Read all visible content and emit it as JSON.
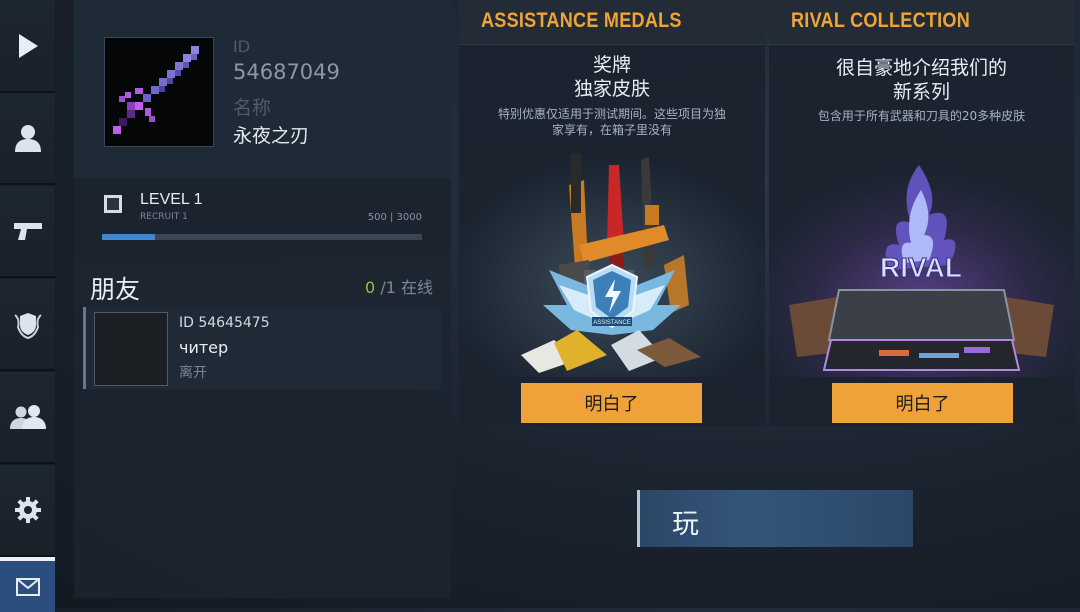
{
  "sidebar": {
    "items": [
      {
        "name": "play-icon"
      },
      {
        "name": "profile-icon"
      },
      {
        "name": "pistol-icon"
      },
      {
        "name": "shield-icon"
      },
      {
        "name": "friends-icon"
      },
      {
        "name": "gear-icon"
      },
      {
        "name": "mail-icon"
      }
    ],
    "active_color": "#2a4e7e"
  },
  "profile": {
    "id_label": "ID",
    "id_value": "54687049",
    "name_label": "名称",
    "name_value": "永夜之刃",
    "avatar_icon": "pixel-sword-icon"
  },
  "level": {
    "title": "LEVEL 1",
    "rank": "RECRUIT 1",
    "xp": "500 | 3000",
    "progress": 0.167
  },
  "friends": {
    "title": "朋友",
    "online_count": "0",
    "separator": "/",
    "total": "1",
    "online_label": "在线",
    "list": [
      {
        "id": "ID 54645475",
        "name": "читер",
        "status": "离开"
      }
    ]
  },
  "offers": [
    {
      "header": "ASSISTANCE MEDALS",
      "title_line1": "奖牌",
      "title_line2": "独家皮肤",
      "desc_line1": "特别优惠仅适用于测试期间。这些项目为独",
      "desc_line2": "家享有，在箱子里没有",
      "art_text": "ASSISTANCE",
      "button": "明白了"
    },
    {
      "header": "RIVAL COLLECTION",
      "title_line1": "很自豪地介绍我们的",
      "title_line2": "新系列",
      "desc_line1": "包含用于所有武器和刀具的20多种皮肤",
      "art_text": "RIVAL",
      "button": "明白了"
    }
  ],
  "play_button": "玩",
  "colors": {
    "accent": "#f0a23a",
    "online": "#8fc63f",
    "xp_bar": "#3f86cc",
    "header_text": "#f0a436"
  }
}
